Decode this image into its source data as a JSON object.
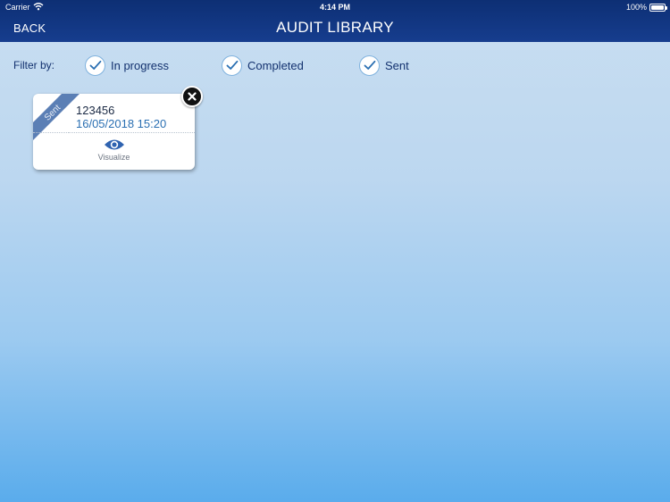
{
  "status_bar": {
    "carrier": "Carrier",
    "time": "4:14 PM",
    "battery": "100%"
  },
  "header": {
    "back_label": "BACK",
    "title": "AUDIT LIBRARY"
  },
  "filters": {
    "label": "Filter by:",
    "items": [
      {
        "label": "In progress",
        "checked": true
      },
      {
        "label": "Completed",
        "checked": true
      },
      {
        "label": "Sent",
        "checked": true
      }
    ]
  },
  "cards": [
    {
      "status": "Sent",
      "id": "123456",
      "date": "16/05/2018 15:20",
      "action_label": "Visualize"
    }
  ],
  "colors": {
    "header": "#0d2f74",
    "accent": "#2a6fb2",
    "ribbon": "#5b7fb5",
    "text": "#13326f"
  }
}
